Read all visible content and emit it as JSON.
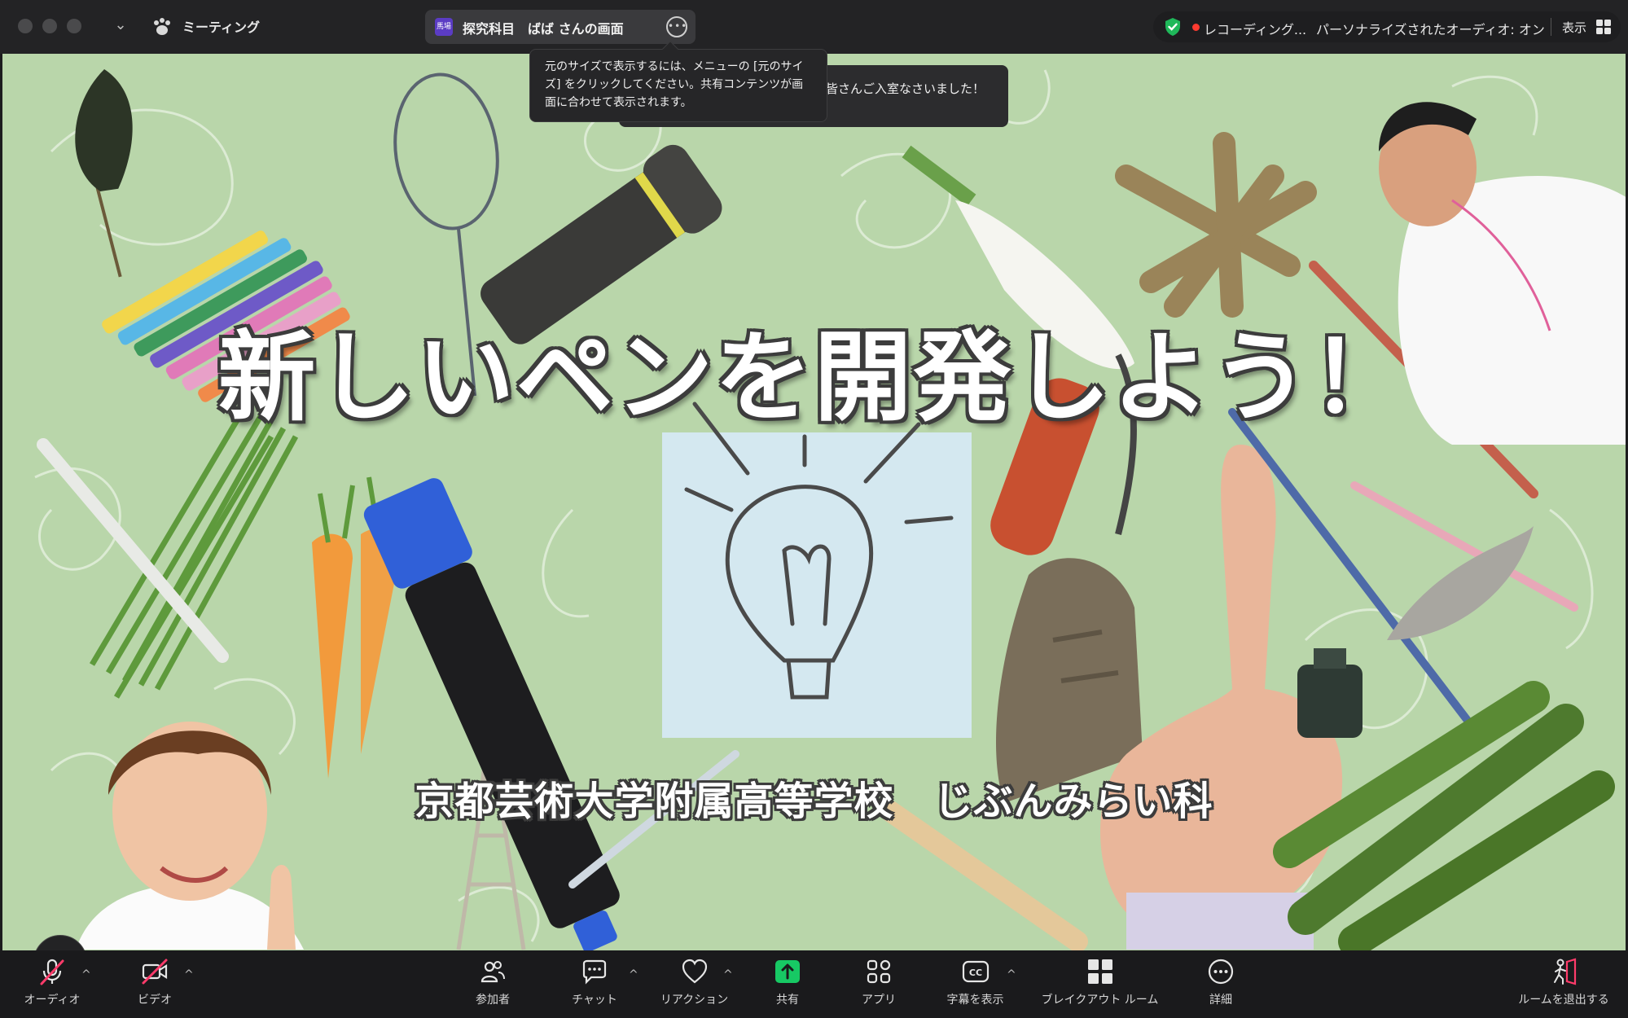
{
  "titlebar": {
    "meeting_label": "ミーティング",
    "share_avatar_text": "馬場",
    "share_title": "探究科目　ばば さんの画面",
    "recording_label": "レコーディング...",
    "audio_label": "パーソナライズされたオーディオ: オン",
    "view_label": "表示"
  },
  "tooltips": {
    "size_tip": "元のサイズで表示するには、メニューの [元のサイズ] をクリックしてください。共有コンテンツが画面に合わせて表示されます。",
    "join_toast": "皆さんご入室なさいました！"
  },
  "slide": {
    "title": "新しいペンを開発しよう！",
    "subtitle": "京都芸術大学附属高等学校　じぶんみらい科"
  },
  "toolbar": {
    "audio": "オーディオ",
    "video": "ビデオ",
    "participants": "参加者",
    "chat": "チャット",
    "reactions": "リアクション",
    "share": "共有",
    "apps": "アプリ",
    "captions": "字幕を表示",
    "breakout": "ブレイクアウト ルーム",
    "more": "詳細",
    "leave": "ルームを退出する"
  },
  "colors": {
    "share_accent": "#17c964",
    "muted_red": "#ff3b6a",
    "stage_bg": "#b7d4a8",
    "shield_green": "#1fb85a"
  }
}
